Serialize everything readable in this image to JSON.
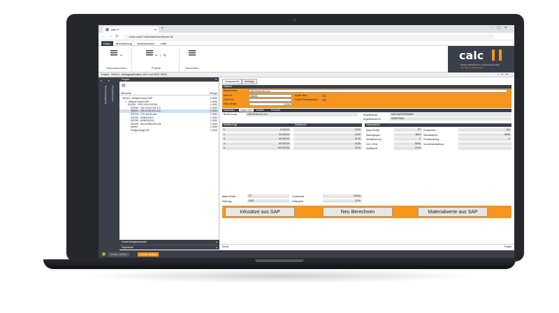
{
  "browser": {
    "tab_title": "calc IT",
    "url": "www.calcIT-kalkulationssoftware.de"
  },
  "menus": [
    "Daten",
    "Modellierung",
    "Administration",
    "Hilfe"
  ],
  "ribbon": {
    "groups": [
      "Stammdatenzeilen",
      "Projekte",
      "Stammdaten"
    ]
  },
  "logo": {
    "text": "calc",
    "version_line": "Version 2019.02.15.1 | Verbindungsmodul",
    "user_line": "Anmelden | Willkommen"
  },
  "project_bar": "Projekt - 000104 - Auftragskalkulation 301C und 302C 3RUS",
  "sidebar": {
    "vertical_labels": [
      "Bearbeitungsliste",
      "Projektbereich"
    ]
  },
  "tree": {
    "header": "Projekt",
    "col_elements": "Elemente",
    "col_menge": "Menge",
    "rows": [
      {
        "label": "000104 - Beispiel Import SAP",
        "menge": "0.0000",
        "indent": 4
      },
      {
        "label": "1 - Beispiel Import SAP",
        "menge": "1.0000",
        "indent": 8
      },
      {
        "label": "E54000 - 301C-204-101RUS",
        "menge": "1.0000",
        "indent": 12
      },
      {
        "label": "537099 - 304-FOGH-001-A-C",
        "menge": "1.0000",
        "indent": 16
      },
      {
        "label": "505251 - 236-SCH6-001-A-A",
        "menge": "1.0000",
        "indent": 16
      },
      {
        "label": "537378 - ETH-40x40-mm",
        "menge": "1.0000",
        "indent": 16
      },
      {
        "label": "542784 - 600634150-1",
        "menge": "1.0000",
        "indent": 16
      },
      {
        "label": "542785 - 600634150-5",
        "menge": "1.0000",
        "indent": 16
      },
      {
        "label": "E54400 - 304-KURB-002-A-B",
        "menge": "1.0000",
        "indent": 16
      },
      {
        "label": "Nutzen",
        "menge": "1.0000",
        "indent": 16
      },
      {
        "label": "Fertigvorträge 300",
        "menge": "1.0000",
        "indent": 16
      }
    ],
    "bottom_panels": [
      "Verwendungsnachweis",
      "Papierkorb"
    ]
  },
  "detail": {
    "tabs": [
      "Komponente",
      "Anhänge"
    ],
    "section_material": "Material",
    "labels": {
      "bezeichnung": "Bezeichnung",
      "sachnr": "Sach-Nr",
      "zeichnr": "Zeichn-Nr",
      "kalk_menge": "Kalk. Menge",
      "kopfer_aktiv": "Kopfer aktiv",
      "kopfer_einsatz": "Kopfer Einsatzgewicht"
    },
    "values": {
      "bezeichnung": "236-SCH6-001-A-A",
      "sachnr": "505251",
      "zeichnr": "",
      "kalk_menge": "10.000"
    },
    "subtabs": [
      "Kalkulation",
      "Import SAP",
      "Textilien",
      "Protokoll"
    ],
    "sap_bezeichnung_label": "Bezeichnung",
    "sap_bezeichnung": "236-SCH6-001-A-A",
    "regel_lieferant_label": "Regellieferant",
    "regel_lieferant": "MAX.MUSTERMANN",
    "regel_lieferant_nr_label": "Regellieferant Nr",
    "regel_lieferant_nr": "0000979020",
    "staffel_headers": [
      "Staffelmenge",
      "Staffelpreis"
    ],
    "staffel_rows": [
      {
        "n": "1",
        "menge": "5.000,00",
        "preis": "37,50"
      },
      {
        "n": "2",
        "menge": "30.000,00",
        "preis": "23,60"
      },
      {
        "n": "3",
        "menge": "50.000,00",
        "preis": "21,90"
      },
      {
        "n": "4",
        "menge": "80.000,00",
        "preis": "21,60"
      },
      {
        "n": "5",
        "menge": "100.000,00",
        "preis": "21,40"
      }
    ],
    "materialwerte_header": "Materialwerte",
    "materialwerte": [
      {
        "l1": "Basis Einheit",
        "v1": "ST",
        "l2": "Preiseinheit",
        "v2": "100"
      },
      {
        "l1": "Warengruppe",
        "v1": "8620",
        "l2": "Standardpreis",
        "v2": "36,56"
      },
      {
        "l1": "Wertsteuerung",
        "v1": "0",
        "l2": "Preissteuerung",
        "v2": "V"
      },
      {
        "l1": "GLD.-Preis",
        "v1": "36,50",
        "l2": "Sonderbeschaffung",
        "v2": ""
      },
      {
        "l1": "Staffelpreis",
        "v1": "37,50",
        "l2": "",
        "v2": ""
      }
    ],
    "bottom_left": [
      {
        "l1": "Basis Einheit",
        "v1": "ST",
        "l2": "Preiseinheit",
        "v2": "100,00"
      },
      {
        "l1": "Währung",
        "v1": "EUR",
        "l2": "Kaltsspreis",
        "v2": "37,50"
      }
    ],
    "buttons": [
      "Infosätze aus SAP",
      "Neu Berechnen",
      "Materialwerte aus SAP"
    ],
    "footer_left": "Suche",
    "footer_right": "Projekt"
  },
  "statusbar": {
    "tabs": [
      "Projekt - 000182",
      "Projekt - 000104"
    ]
  },
  "colors": {
    "accent": "#f7941d",
    "dark": "#3b3f4a"
  }
}
